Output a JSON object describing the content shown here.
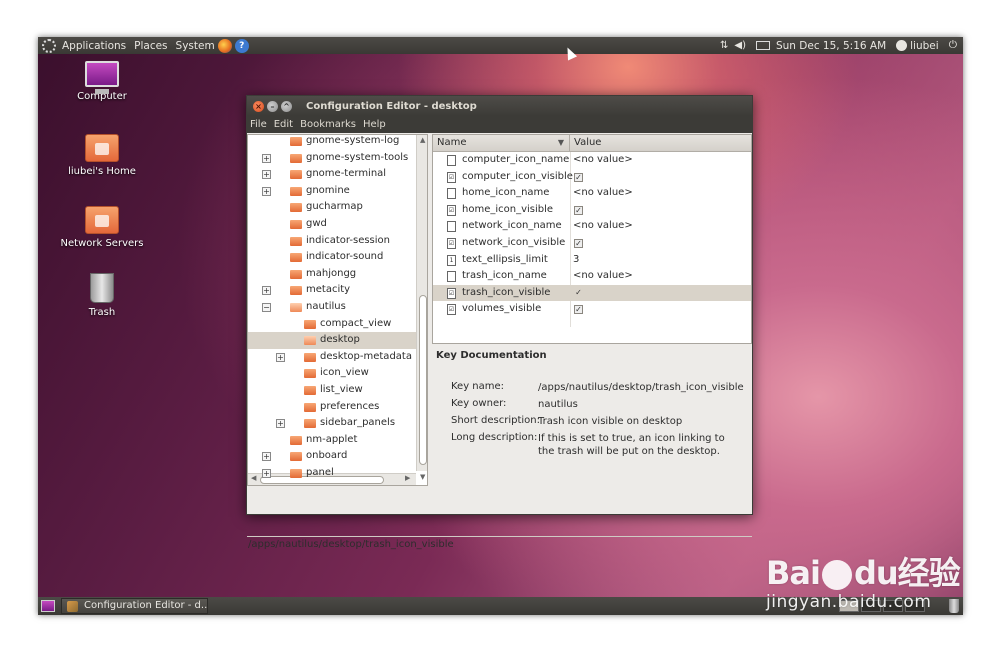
{
  "top_panel": {
    "menus": [
      "Applications",
      "Places",
      "System"
    ],
    "clock": "Sun Dec 15,  5:16 AM",
    "user": "liubei"
  },
  "desktop_icons": [
    {
      "label": "Computer",
      "icon": "computer-icon"
    },
    {
      "label": "liubei's Home",
      "icon": "home-folder-icon"
    },
    {
      "label": "Network Servers",
      "icon": "network-folder-icon"
    },
    {
      "label": "Trash",
      "icon": "trash-icon"
    }
  ],
  "window": {
    "title": "Configuration Editor - desktop",
    "menu": [
      "File",
      "Edit",
      "Bookmarks",
      "Help"
    ],
    "tree": [
      {
        "label": "gnome-system-log",
        "expander": "",
        "indent": 0
      },
      {
        "label": "gnome-system-tools",
        "expander": "+",
        "indent": 0
      },
      {
        "label": "gnome-terminal",
        "expander": "+",
        "indent": 0
      },
      {
        "label": "gnomine",
        "expander": "+",
        "indent": 0
      },
      {
        "label": "gucharmap",
        "expander": "",
        "indent": 0
      },
      {
        "label": "gwd",
        "expander": "",
        "indent": 0
      },
      {
        "label": "indicator-session",
        "expander": "",
        "indent": 0
      },
      {
        "label": "indicator-sound",
        "expander": "",
        "indent": 0
      },
      {
        "label": "mahjongg",
        "expander": "",
        "indent": 0
      },
      {
        "label": "metacity",
        "expander": "+",
        "indent": 0
      },
      {
        "label": "nautilus",
        "expander": "−",
        "indent": 0,
        "open": true
      },
      {
        "label": "compact_view",
        "expander": "",
        "indent": 1
      },
      {
        "label": "desktop",
        "expander": "",
        "indent": 1,
        "selected": true,
        "open": true
      },
      {
        "label": "desktop-metadata",
        "expander": "+",
        "indent": 1
      },
      {
        "label": "icon_view",
        "expander": "",
        "indent": 1
      },
      {
        "label": "list_view",
        "expander": "",
        "indent": 1
      },
      {
        "label": "preferences",
        "expander": "",
        "indent": 1
      },
      {
        "label": "sidebar_panels",
        "expander": "+",
        "indent": 1
      },
      {
        "label": "nm-applet",
        "expander": "",
        "indent": 0
      },
      {
        "label": "onboard",
        "expander": "+",
        "indent": 0
      },
      {
        "label": "panel",
        "expander": "+",
        "indent": 0
      }
    ],
    "list_headers": {
      "name": "Name",
      "value": "Value"
    },
    "keys": [
      {
        "name": "computer_icon_name",
        "type": "string",
        "value": "<no value>"
      },
      {
        "name": "computer_icon_visible",
        "type": "bool",
        "value": "✓"
      },
      {
        "name": "home_icon_name",
        "type": "string",
        "value": "<no value>"
      },
      {
        "name": "home_icon_visible",
        "type": "bool",
        "value": "✓"
      },
      {
        "name": "network_icon_name",
        "type": "string",
        "value": "<no value>"
      },
      {
        "name": "network_icon_visible",
        "type": "bool",
        "value": "✓"
      },
      {
        "name": "text_ellipsis_limit",
        "type": "int",
        "value": "3"
      },
      {
        "name": "trash_icon_name",
        "type": "string",
        "value": "<no value>"
      },
      {
        "name": "trash_icon_visible",
        "type": "bool",
        "value": "✓",
        "selected": true
      },
      {
        "name": "volumes_visible",
        "type": "bool",
        "value": "✓"
      }
    ],
    "doc": {
      "title": "Key Documentation",
      "key_name_label": "Key name:",
      "key_name": "/apps/nautilus/desktop/trash_icon_visible",
      "key_owner_label": "Key owner:",
      "key_owner": "nautilus",
      "short_label": "Short description:",
      "short": "Trash icon visible on desktop",
      "long_label": "Long description:",
      "long": "If this is set to true, an icon linking to the trash will be put on the desktop."
    },
    "status": "/apps/nautilus/desktop/trash_icon_visible"
  },
  "bottom_panel": {
    "task": "Configuration Editor - d..."
  },
  "watermark": {
    "logo_left": "Bai",
    "logo_mid": "du",
    "logo_right": "经验",
    "url": "jingyan.baidu.com"
  }
}
